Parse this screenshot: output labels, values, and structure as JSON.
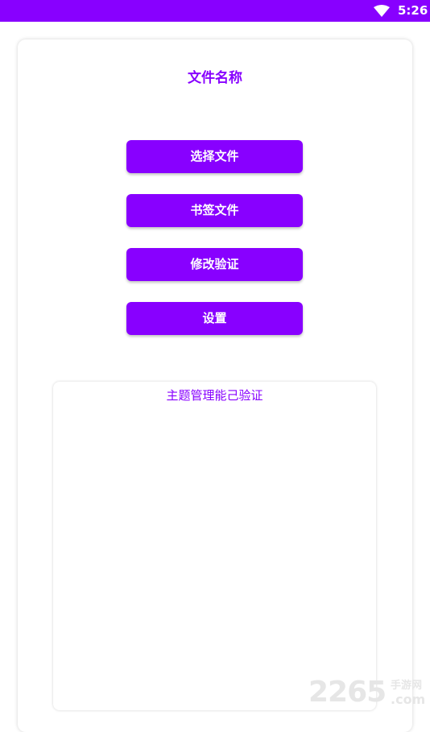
{
  "status_bar": {
    "time": "5:26",
    "wifi_icon": "wifi-icon",
    "background": "#8800ff"
  },
  "main": {
    "title": "文件名称",
    "buttons": [
      {
        "label": "选择文件"
      },
      {
        "label": "书签文件"
      },
      {
        "label": "修改验证"
      },
      {
        "label": "设置"
      }
    ],
    "theme_box": {
      "label": "主题管理能己验证"
    },
    "accent_color": "#8800ff"
  },
  "watermark": {
    "number": "2265",
    "site_cn": "手游网",
    "site_suffix": ".com"
  }
}
